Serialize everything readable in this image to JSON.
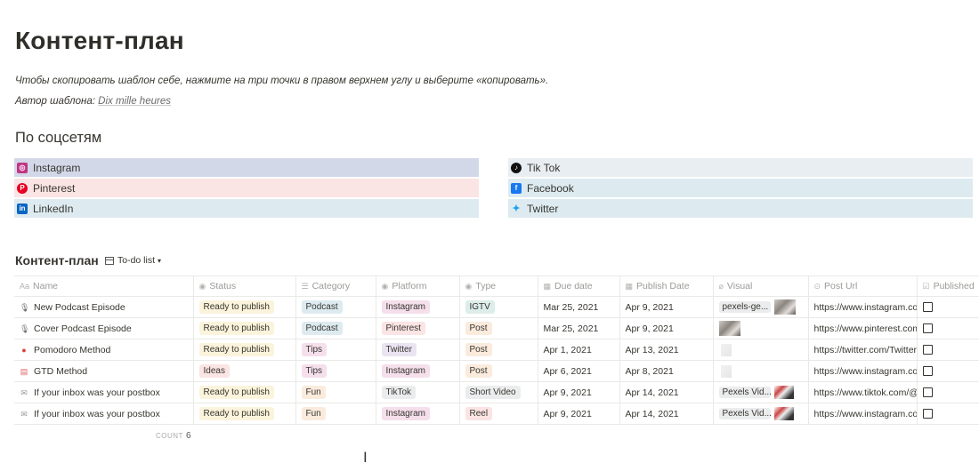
{
  "page": {
    "title": "Контент-план",
    "intro": "Чтобы скопировать шаблон себе, нажмите на три точки в правом верхнем углу и выберите «копировать».",
    "author_label": "Автор шаблона:",
    "author_name": "Dix mille heures"
  },
  "socials": {
    "title": "По соцсетям",
    "left": [
      {
        "label": "Instagram",
        "icon": "instagram-icon",
        "bg": "#d3d8e9",
        "icon_color": "#c13584"
      },
      {
        "label": "Pinterest",
        "icon": "pinterest-icon",
        "bg": "#fbe4e4",
        "icon_color": "#e60023"
      },
      {
        "label": "LinkedIn",
        "icon": "linkedin-icon",
        "bg": "#ddebf1",
        "icon_color": "#0a66c2"
      }
    ],
    "right": [
      {
        "label": "Tik Tok",
        "icon": "tiktok-icon",
        "bg": "#e8eef1",
        "icon_color": "#111111"
      },
      {
        "label": "Facebook",
        "icon": "facebook-icon",
        "bg": "#ddebf1",
        "icon_color": "#1877f2"
      },
      {
        "label": "Twitter",
        "icon": "twitter-icon",
        "bg": "#ddebf1",
        "icon_color": "#1da1f2"
      }
    ]
  },
  "database": {
    "title": "Контент-план",
    "view_label": "To-do list",
    "columns": [
      "Name",
      "Status",
      "Category",
      "Platform",
      "Type",
      "Due date",
      "Publish Date",
      "Visual",
      "Post Url",
      "Published"
    ],
    "rows": [
      {
        "name": "New Podcast Episode",
        "icon": "microphone-icon",
        "status": "Ready to publish",
        "category": "Podcast",
        "platform": "Instagram",
        "type": "IGTV",
        "due": "Mar 25, 2021",
        "publish": "Apr 9, 2021",
        "visual": "pexels-ge...",
        "url": "https://www.instagram.com/",
        "published": false
      },
      {
        "name": "Cover Podcast Episode",
        "icon": "microphone-icon",
        "status": "Ready to publish",
        "category": "Podcast",
        "platform": "Pinterest",
        "type": "Post",
        "due": "Mar 25, 2021",
        "publish": "Apr 9, 2021",
        "visual": "",
        "url": "https://www.pinterest.com/",
        "published": false
      },
      {
        "name": "Pomodoro Method",
        "icon": "tomato-icon",
        "status": "Ready to publish",
        "category": "Tips",
        "platform": "Twitter",
        "type": "Post",
        "due": "Apr 1, 2021",
        "publish": "Apr 13, 2021",
        "visual": "",
        "url": "https://twitter.com/Twitter",
        "published": false
      },
      {
        "name": "GTD Method",
        "icon": "calendar-icon",
        "status": "Ideas",
        "category": "Tips",
        "platform": "Instagram",
        "type": "Post",
        "due": "Apr 6, 2021",
        "publish": "Apr 8, 2021",
        "visual": "",
        "url": "https://www.instagram.com/",
        "published": false
      },
      {
        "name": "If your inbox was your postbox",
        "icon": "envelope-icon",
        "status": "Ready to publish",
        "category": "Fun",
        "platform": "TikTok",
        "type": "Short Video",
        "due": "Apr 9, 2021",
        "publish": "Apr 14, 2021",
        "visual": "Pexels Vid...",
        "url": "https://www.tiktok.com/@",
        "published": false
      },
      {
        "name": "If your inbox was your postbox",
        "icon": "envelope-icon",
        "status": "Ready to publish",
        "category": "Fun",
        "platform": "Instagram",
        "type": "Reel",
        "due": "Apr 9, 2021",
        "publish": "Apr 14, 2021",
        "visual": "Pexels Vid...",
        "url": "https://www.instagram.com/",
        "published": false
      }
    ],
    "count_label": "COUNT",
    "count_value": "6"
  },
  "tag_colors": {
    "Ready to publish": "#fbf3db",
    "Ideas": "#fbe4e4",
    "Podcast": "#ddebf1",
    "Tips": "#f4dfeb",
    "Fun": "#faebdd",
    "Instagram": "#f4dfeb",
    "Pinterest": "#fbe4e4",
    "Twitter": "#eae4f2",
    "TikTok": "#ebeced",
    "IGTV": "#ddedea",
    "Post": "#faebdd",
    "Short Video": "#ebeced",
    "Reel": "#fbe4e4"
  }
}
